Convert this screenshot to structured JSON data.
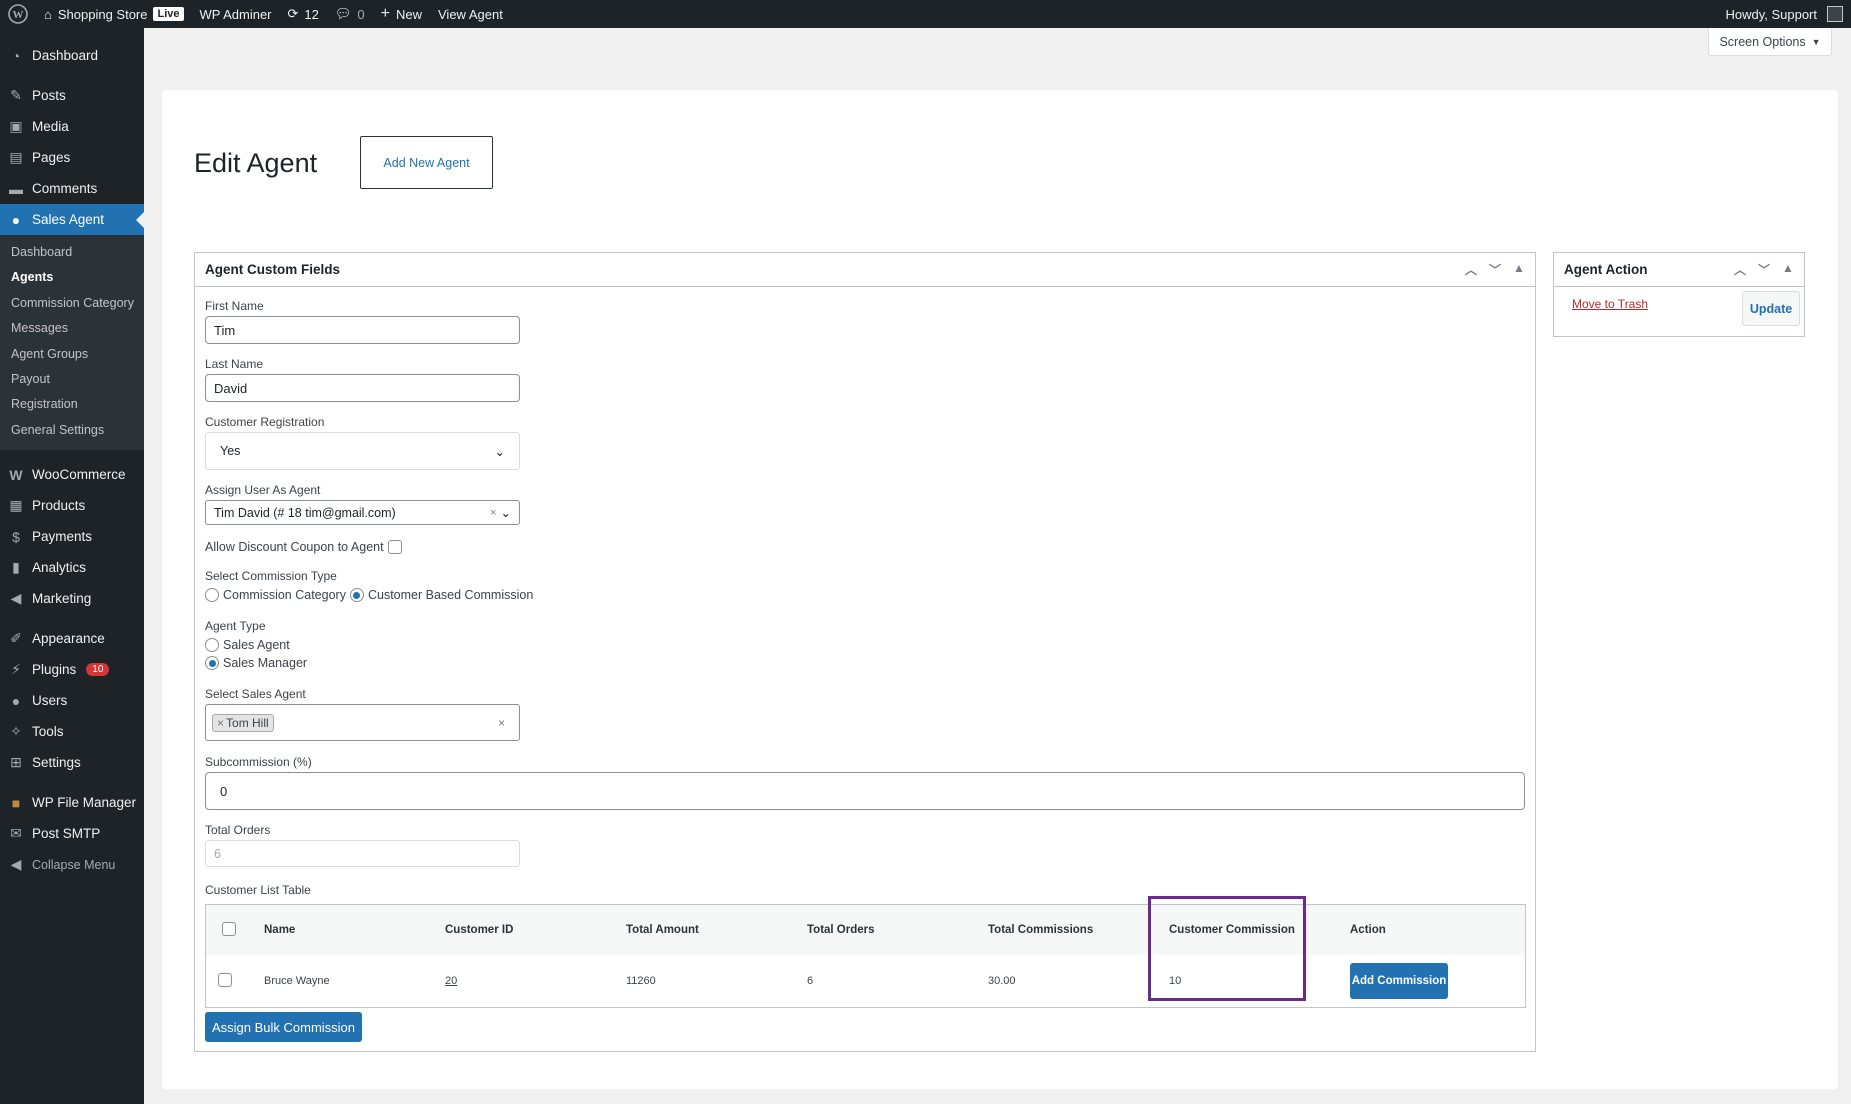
{
  "adminbar": {
    "site_name": "Shopping Store",
    "live": "Live",
    "plugin": "WP Adminer",
    "updates": "12",
    "comments": "0",
    "new": "New",
    "view": "View Agent",
    "howdy": "Howdy, Support"
  },
  "sidebar": {
    "items": [
      {
        "label": "Dashboard",
        "icon": "dashboard-icon"
      },
      {
        "label": "Posts",
        "icon": "pin-icon"
      },
      {
        "label": "Media",
        "icon": "media-icon"
      },
      {
        "label": "Pages",
        "icon": "pages-icon"
      },
      {
        "label": "Comments",
        "icon": "comment-icon"
      },
      {
        "label": "Sales Agent",
        "icon": "person-icon"
      }
    ],
    "submenu": [
      "Dashboard",
      "Agents",
      "Commission Category",
      "Messages",
      "Agent Groups",
      "Payout",
      "Registration",
      "General Settings"
    ],
    "items2": [
      {
        "label": "WooCommerce",
        "icon": "woo-icon"
      },
      {
        "label": "Products",
        "icon": "archive-icon"
      },
      {
        "label": "Payments",
        "icon": "dollar-icon"
      },
      {
        "label": "Analytics",
        "icon": "bar-chart-icon"
      },
      {
        "label": "Marketing",
        "icon": "megaphone-icon"
      }
    ],
    "items3": [
      {
        "label": "Appearance",
        "icon": "brush-icon"
      },
      {
        "label": "Plugins",
        "icon": "plugin-icon",
        "badge": "10"
      },
      {
        "label": "Users",
        "icon": "users-icon"
      },
      {
        "label": "Tools",
        "icon": "wrench-icon"
      },
      {
        "label": "Settings",
        "icon": "settings-icon"
      }
    ],
    "items4": [
      {
        "label": "WP File Manager",
        "icon": "folder-icon"
      },
      {
        "label": "Post SMTP",
        "icon": "email-icon"
      }
    ],
    "collapse": "Collapse Menu"
  },
  "screen_options": "Screen Options",
  "page": {
    "title": "Edit Agent",
    "add_new": "Add New Agent"
  },
  "custom_fields": {
    "title": "Agent Custom Fields",
    "first_name_label": "First Name",
    "first_name": "Tim",
    "last_name_label": "Last Name",
    "last_name": "David",
    "registration_label": "Customer Registration",
    "registration": "Yes",
    "assign_label": "Assign User As Agent",
    "assign": "Tim David (# 18 tim@gmail.com)",
    "coupon_label": "Allow Discount Coupon to Agent",
    "commission_type_label": "Select Commission Type",
    "commission_type_options": [
      "Commission Category",
      "Customer Based Commission"
    ],
    "agent_type_label": "Agent Type",
    "agent_type_options": [
      "Sales Agent",
      "Sales Manager"
    ],
    "sales_agent_label": "Select Sales Agent",
    "sales_agent_tag": "Tom Hill",
    "subcommission_label": "Subcommission (%)",
    "subcommission": "0",
    "total_orders_label": "Total Orders",
    "total_orders": "6",
    "table_label": "Customer List Table",
    "table": {
      "headers": [
        "Name",
        "Customer ID",
        "Total Amount",
        "Total Orders",
        "Total Commissions",
        "Customer Commission",
        "Action"
      ],
      "rows": [
        {
          "name": "Bruce Wayne",
          "id": "20",
          "amount": "11260",
          "orders": "6",
          "commissions": "30.00",
          "customer_commission": "10",
          "action": "Add Commission"
        }
      ]
    },
    "bulk_button": "Assign Bulk Commission"
  },
  "agent_action": {
    "title": "Agent Action",
    "trash": "Move to Trash",
    "update": "Update"
  },
  "colors": {
    "accent": "#2271b1",
    "highlight": "#6b2a8f",
    "sidebar": "#1d2327"
  }
}
